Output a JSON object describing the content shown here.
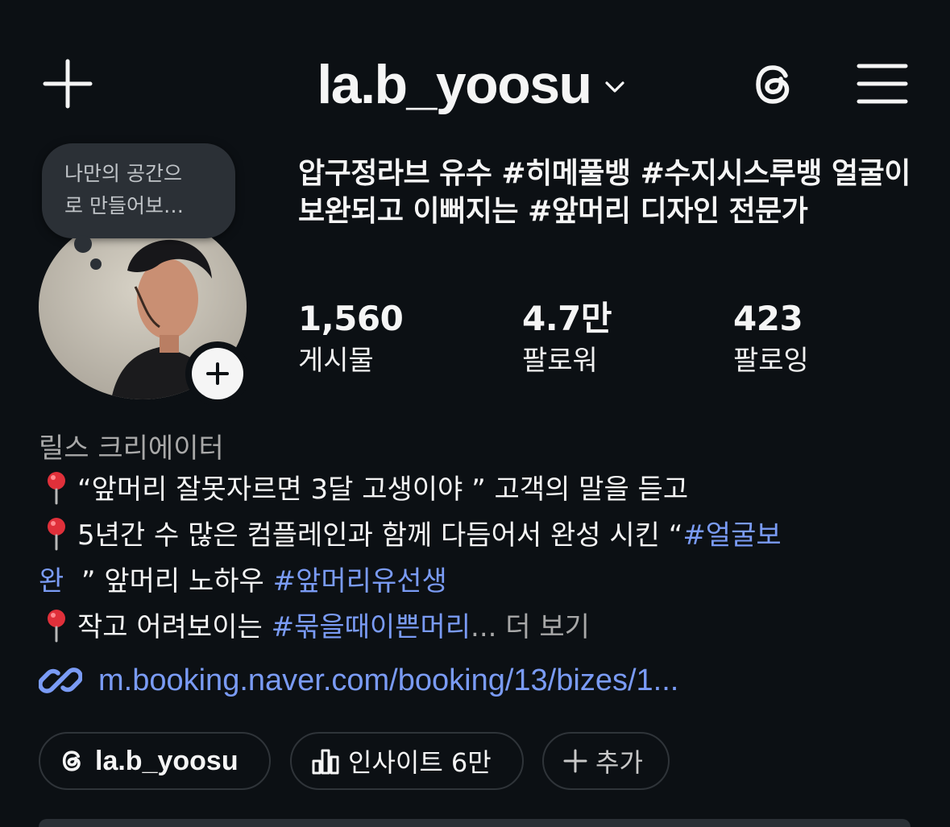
{
  "header": {
    "username": "la.b_yoosu",
    "icons": [
      "plus-icon",
      "chevron-down-icon",
      "threads-icon",
      "menu-icon"
    ]
  },
  "note": {
    "line1": "나만의 공간으",
    "line2": "로 만들어보…"
  },
  "profile": {
    "headline": "압구정라브 유수 #히메풀뱅 #수지시스루뱅 얼굴이 보완되고 이뻐지는 #앞머리 디자인 전문가"
  },
  "stats": {
    "posts": {
      "value": "1,560",
      "label": "게시물"
    },
    "followers": {
      "value": "4.7만",
      "label": "팔로워"
    },
    "following": {
      "value": "423",
      "label": "팔로잉"
    }
  },
  "bio": {
    "category": "릴스 크리에이터",
    "line1": "“앞머리 잘못자르면 3달 고생이야 ” 고객의 말을 듣고",
    "line2_text": "5년간 수 많은 컴플레인과 함께 다듬어서 완성 시킨 “",
    "line2_hash": "#얼굴보",
    "line3_hash_cont": "완",
    "line3_text": "  ” 앞머리 노하우 ",
    "line3_hash": "#앞머리유선생",
    "line4_text": "작고 어려보이는 ",
    "line4_hash": "#묶을때이쁜머리",
    "more_label": "... 더 보기"
  },
  "link": {
    "text": "m.booking.naver.com/booking/13/bizes/1..."
  },
  "chips": {
    "threads": "la.b_yoosu",
    "insights": "인사이트 6만",
    "add": "추가"
  },
  "colors": {
    "background": "#0c1014",
    "text": "#f5f5f5",
    "muted": "#a8a8a8",
    "link": "#7a9bf5",
    "chip_border": "#2f3439",
    "note_bg": "#2b3036"
  }
}
